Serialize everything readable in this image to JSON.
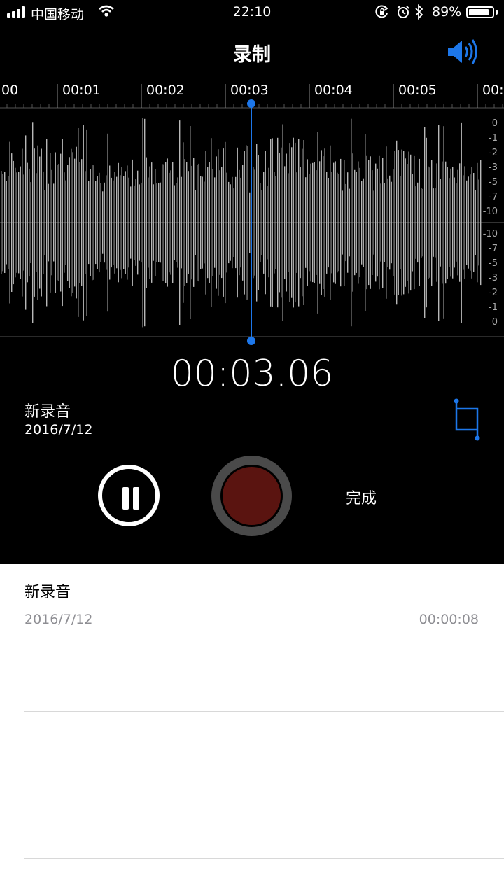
{
  "status_bar": {
    "carrier": "中国移动",
    "time": "22:10",
    "battery_percent": "89%",
    "battery_level": 0.89
  },
  "nav": {
    "title": "录制",
    "speaker_icon": "speaker-volume-icon"
  },
  "timeline": {
    "labels": [
      "00",
      "00:01",
      "00:02",
      "00:03",
      "00:04",
      "00:05",
      "00:"
    ]
  },
  "db_scale": [
    "0",
    "-1",
    "-2",
    "-3",
    "-5",
    "-7",
    "-10",
    "-10",
    "-7",
    "-5",
    "-3",
    "-2",
    "-1",
    "0"
  ],
  "recorder": {
    "elapsed": "00:03.06",
    "name": "新录音",
    "date": "2016/7/12",
    "done_label": "完成",
    "accent": "#1d77ea",
    "record_color": "#5a1410"
  },
  "recordings": [
    {
      "name": "新录音",
      "date": "2016/7/12",
      "duration": "00:00:08"
    }
  ],
  "icons": [
    "signal-icon",
    "wifi-icon",
    "rotation-lock-icon",
    "alarm-icon",
    "bluetooth-icon",
    "battery-icon",
    "speaker-volume-icon",
    "trim-icon",
    "pause-icon",
    "record-icon"
  ]
}
